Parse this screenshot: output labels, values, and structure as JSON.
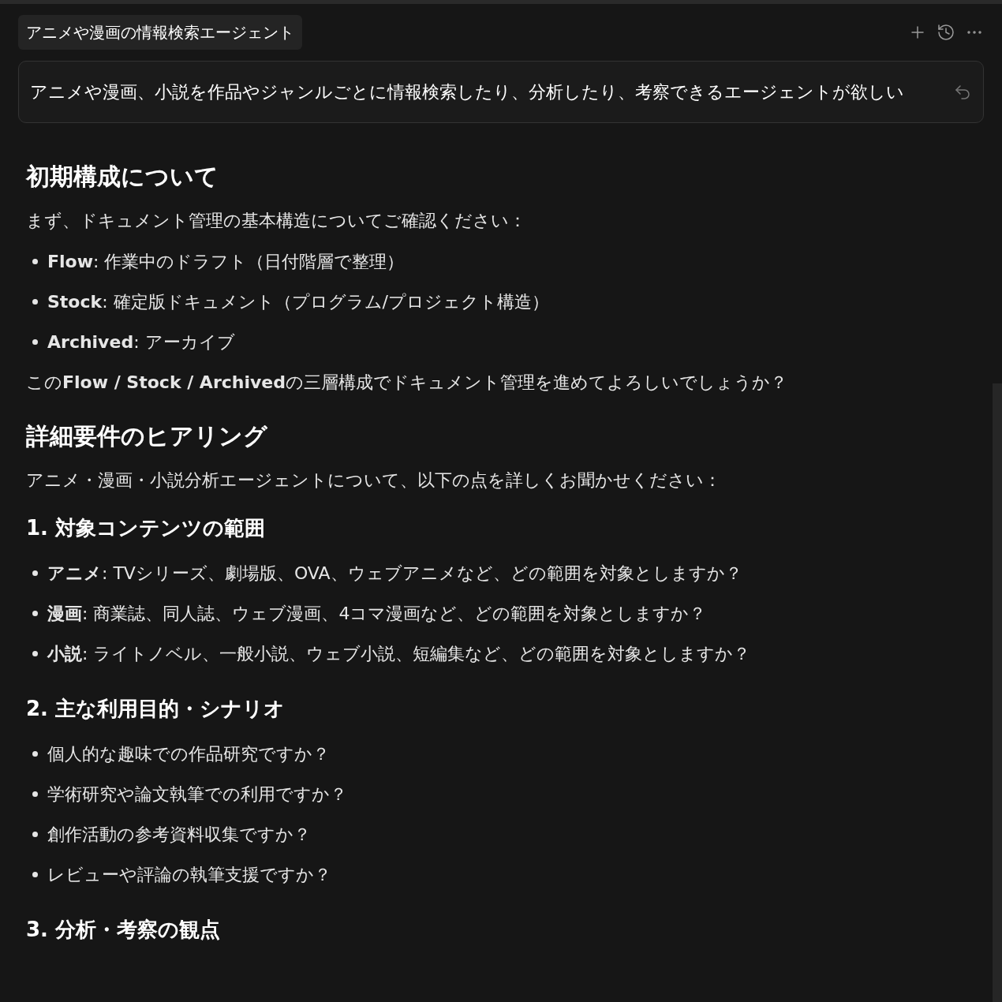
{
  "header": {
    "title": "アニメや漫画の情報検索エージェント"
  },
  "prompt": {
    "text": "アニメや漫画、小説を作品やジャンルごとに情報検索したり、分析したり、考察できるエージェントが欲しい"
  },
  "blocks": [
    {
      "kind": "heading",
      "text": "初期構成について"
    },
    {
      "kind": "paragraph",
      "text": "まず、ドキュメント管理の基本構造についてご確認ください："
    },
    {
      "kind": "bullets",
      "items": [
        "**Flow**: 作業中のドラフト（日付階層で整理）",
        "**Stock**: 確定版ドキュメント（プログラム/プロジェクト構造）",
        "**Archived**: アーカイブ"
      ]
    },
    {
      "kind": "paragraph",
      "text": "この**Flow / Stock / Archived**の三層構成でドキュメント管理を進めてよろしいでしょうか？"
    },
    {
      "kind": "heading",
      "text": "詳細要件のヒアリング"
    },
    {
      "kind": "paragraph",
      "text": "アニメ・漫画・小説分析エージェントについて、以下の点を詳しくお聞かせください："
    },
    {
      "kind": "subheading",
      "text": "1. 対象コンテンツの範囲"
    },
    {
      "kind": "bullets",
      "items": [
        "**アニメ**: TVシリーズ、劇場版、OVA、ウェブアニメなど、どの範囲を対象としますか？",
        "**漫画**: 商業誌、同人誌、ウェブ漫画、4コマ漫画など、どの範囲を対象としますか？",
        "**小説**: ライトノベル、一般小説、ウェブ小説、短編集など、どの範囲を対象としますか？"
      ]
    },
    {
      "kind": "subheading",
      "text": "2. 主な利用目的・シナリオ"
    },
    {
      "kind": "bullets",
      "items": [
        "個人的な趣味での作品研究ですか？",
        "学術研究や論文執筆での利用ですか？",
        "創作活動の参考資料収集ですか？",
        "レビューや評論の執筆支援ですか？"
      ]
    },
    {
      "kind": "subheading",
      "text": "3. 分析・考察の観点"
    }
  ]
}
